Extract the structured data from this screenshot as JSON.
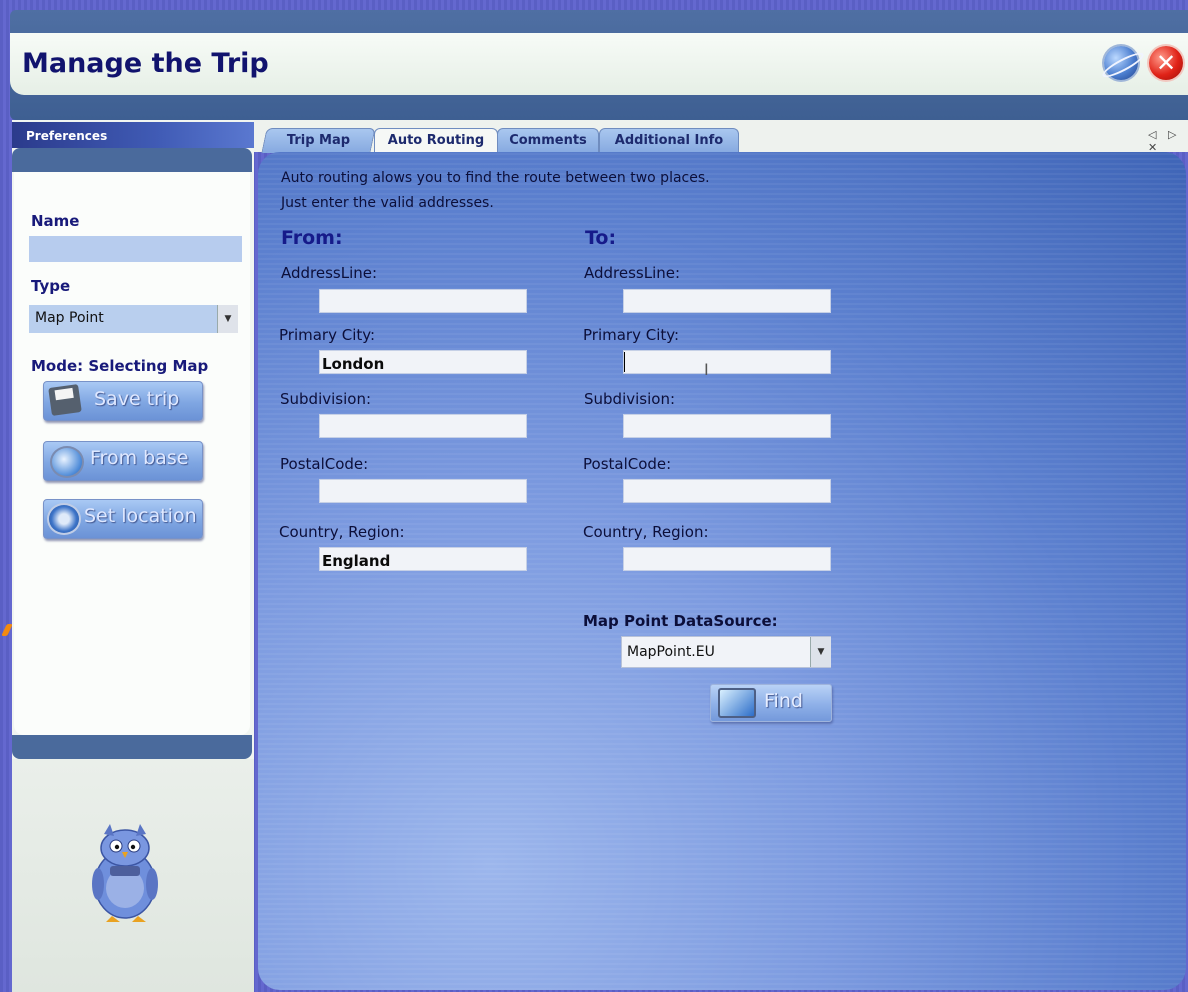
{
  "app": {
    "title": "Manage the Trip"
  },
  "header": {
    "buttons": [
      {
        "name": "globe",
        "icon": "globe-icon"
      },
      {
        "name": "close",
        "icon": "close-icon",
        "glyph": "✕"
      }
    ]
  },
  "sidebar": {
    "section_title": "Preferences",
    "name_label": "Name",
    "name_value": "",
    "type_label": "Type",
    "type_selected": "Map Point",
    "mode_label": "Mode: Selecting Map",
    "buttons": {
      "save": "Save trip",
      "from_base": "From base",
      "set_location": "Set location"
    }
  },
  "tabs": [
    {
      "label": "Trip Map",
      "active": false
    },
    {
      "label": "Auto Routing",
      "active": true
    },
    {
      "label": "Comments",
      "active": false
    },
    {
      "label": "Additional Info",
      "active": false
    }
  ],
  "tab_scroll": "◁ ▷ ✕",
  "auto_routing": {
    "description_line1": "Auto routing alows you to find the route between two places.",
    "description_line2": "Just enter the valid addresses.",
    "from": {
      "heading": "From:",
      "address_label": "AddressLine:",
      "address_value": "",
      "city_label": "Primary City:",
      "city_value": "London",
      "subdivision_label": "Subdivision:",
      "subdivision_value": "",
      "postal_label": "PostalCode:",
      "postal_value": "",
      "country_label": "Country, Region:",
      "country_value": "England"
    },
    "to": {
      "heading": "To:",
      "address_label": "AddressLine:",
      "address_value": "",
      "city_label": "Primary City:",
      "city_value": "",
      "subdivision_label": "Subdivision:",
      "subdivision_value": "",
      "postal_label": "PostalCode:",
      "postal_value": "",
      "country_label": "Country, Region:",
      "country_value": ""
    },
    "datasource_label": "Map Point DataSource:",
    "datasource_selected": "MapPoint.EU",
    "find_label": "Find"
  },
  "colors": {
    "title": "#11136e",
    "panel": "#5c80cf",
    "tab_active": "#f6f8f6",
    "tab_inactive": "#a9c7ef",
    "close_red": "#e02318"
  }
}
